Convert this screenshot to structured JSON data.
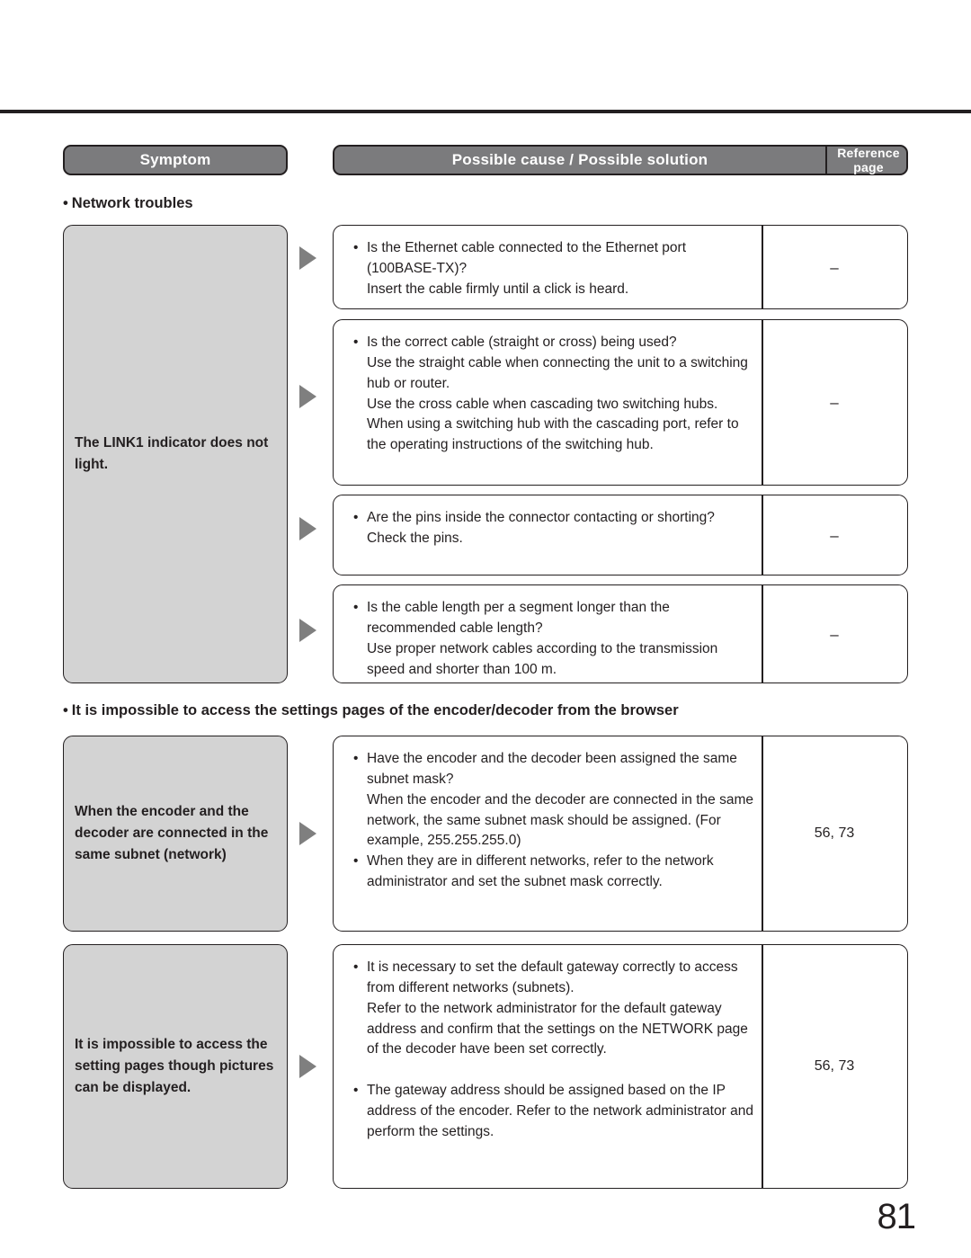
{
  "page": {
    "number": "81"
  },
  "table_header": {
    "symptom": "Symptom",
    "cause": "Possible cause / Possible solution",
    "reference": "Reference page"
  },
  "sections": [
    {
      "heading": "Network troubles",
      "bullet": "•",
      "symptom": "The LINK1 indicator does not light.",
      "rows": [
        {
          "items": [
            {
              "bullet": "•",
              "lines": "Is the Ethernet cable connected to the Ethernet port (100BASE-TX)?\nInsert the cable firmly until a click is heard."
            }
          ],
          "reference": "–"
        },
        {
          "items": [
            {
              "bullet": "•",
              "lines": "Is the correct cable (straight or cross) being used?\nUse the straight cable when connecting the unit to a switching hub or router.\nUse the cross cable when cascading two switching hubs. When using a switching hub with the cascading port, refer to the operating instructions of the switching hub."
            }
          ],
          "reference": "–"
        },
        {
          "items": [
            {
              "bullet": "•",
              "lines": "Are the pins inside the connector contacting or shorting?\nCheck the pins."
            }
          ],
          "reference": "–"
        },
        {
          "items": [
            {
              "bullet": "•",
              "lines": "Is the cable length per a segment longer than the recommended cable length?\nUse proper network cables according to the transmission speed and shorter than 100 m."
            }
          ],
          "reference": "–"
        }
      ]
    },
    {
      "heading": "It is impossible to access the settings pages of the encoder/decoder from the browser",
      "bullet": "•",
      "rows": [
        {
          "symptom": "When the encoder and the decoder are connected in the same subnet (network)",
          "items": [
            {
              "bullet": "•",
              "lines": "Have the encoder and the decoder been assigned the same subnet mask?\nWhen the encoder and the decoder are connected in the same network, the same subnet mask should be assigned. (For example, 255.255.255.0)"
            },
            {
              "bullet": "•",
              "lines": "When they are in different networks, refer to the network administrator and set the subnet mask correctly."
            }
          ],
          "reference": "56, 73"
        },
        {
          "symptom": "It is impossible to access the setting pages though pictures can be displayed.",
          "items": [
            {
              "bullet": "•",
              "lines": "It is necessary to set the default gateway correctly to access from different networks (subnets).\nRefer to the network administrator for the default gateway address and confirm that the settings on the NETWORK page of the decoder have been set correctly."
            },
            {
              "bullet": "•",
              "lines": "The gateway address should be assigned based on the IP address of the encoder. Refer to the network administrator and perform the settings."
            }
          ],
          "reference": "56, 73"
        }
      ]
    }
  ],
  "colors": {
    "header_bar": "#7b7b7d",
    "symptom_fill": "#d3d3d3",
    "arrow": "#7f7f7f",
    "ink": "#231f20"
  }
}
